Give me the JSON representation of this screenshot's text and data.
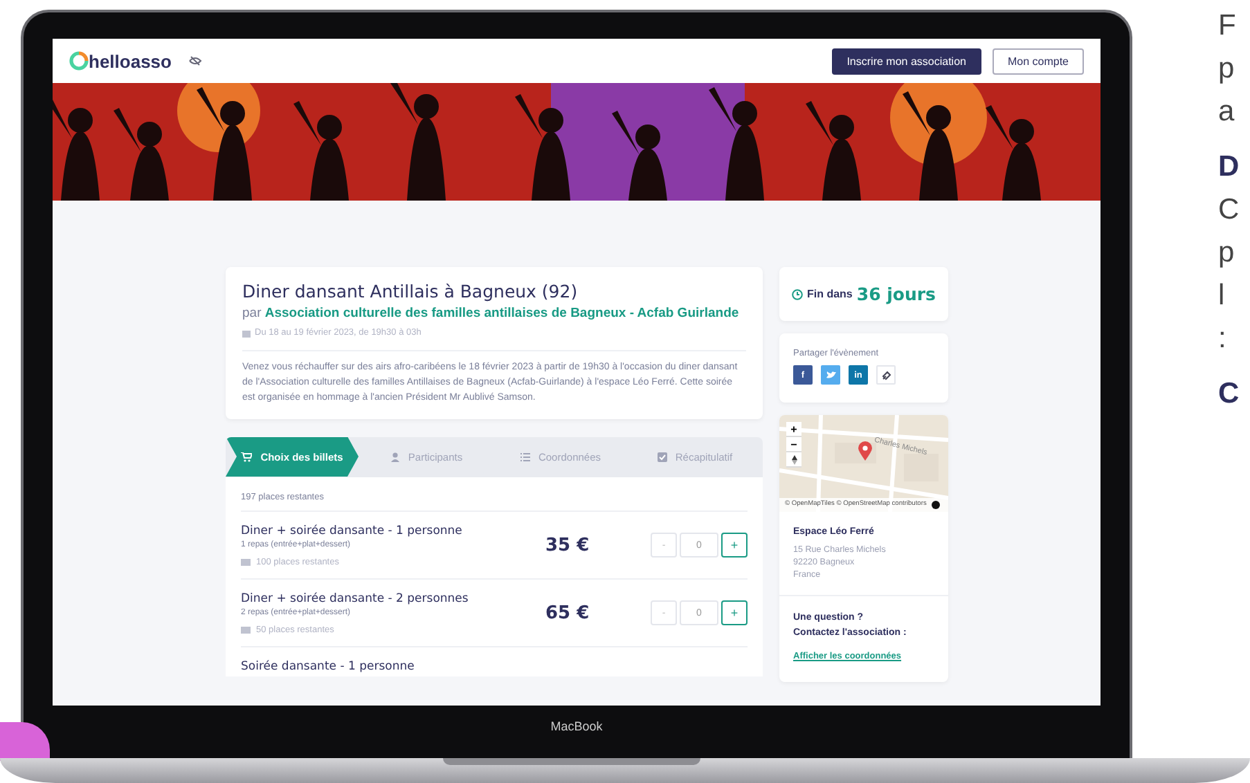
{
  "nav": {
    "logo": "helloasso",
    "primary_button": "Inscrire mon association",
    "secondary_button": "Mon compte"
  },
  "event": {
    "title": "Diner dansant Antillais à Bagneux (92)",
    "by_prefix": "par",
    "organizer": "Association culturelle des familles antillaises de Bagneux - Acfab Guirlande",
    "date": "Du 18 au 19 février 2023, de 19h30 à 03h",
    "description": "Venez vous réchauffer sur des airs afro-caribéens le 18 février 2023 à partir de 19h30 à l'occasion du diner dansant de l'Association culturelle des familles Antillaises de Bagneux (Acfab-Guirlande) à l'espace Léo Ferré. Cette soirée est organisée en hommage à l'ancien Président Mr Aublivé Samson."
  },
  "steps": [
    {
      "label": "Choix des billets",
      "selected": true,
      "kind": "cart"
    },
    {
      "label": "Participants",
      "selected": false,
      "kind": "person"
    },
    {
      "label": "Coordonnées",
      "selected": false,
      "kind": "list"
    },
    {
      "label": "Récapitulatif",
      "selected": false,
      "kind": "check"
    }
  ],
  "remaining": "197 places restantes",
  "tickets": [
    {
      "name": "Diner + soirée dansante - 1 personne",
      "detail": "1 repas (entrée+plat+dessert)",
      "availability": "100 places restantes",
      "price": "35 €",
      "decrement": "-",
      "quantity": "0",
      "increment": "+"
    },
    {
      "name": "Diner + soirée dansante - 2 personnes",
      "detail": "2 repas (entrée+plat+dessert)",
      "availability": "50 places restantes",
      "price": "65 €",
      "decrement": "-",
      "quantity": "0",
      "increment": "+"
    },
    {
      "name": "Soirée dansante - 1 personne"
    }
  ],
  "countdown": {
    "prefix": "Fin dans",
    "value": "36 jours"
  },
  "share": {
    "title": "Partager l'évènement",
    "buttons": [
      {
        "kind": "facebook",
        "label": "f"
      },
      {
        "kind": "twitter"
      },
      {
        "kind": "linkedin",
        "label": "in"
      },
      {
        "kind": "link"
      }
    ]
  },
  "map": {
    "zoom_in": "+",
    "zoom_out": "−",
    "street": "Charles Michels",
    "attribution": "© OpenMapTiles © OpenStreetMap contributors"
  },
  "venue": {
    "name": "Espace Léo Ferré",
    "address": [
      "15 Rue Charles Michels",
      "92220 Bagneux",
      "France"
    ]
  },
  "contact": {
    "question": "Une question ?",
    "prompt": "Contactez l'association :",
    "link": "Afficher les coordonnées"
  },
  "device_label": "MacBook",
  "side_text": [
    {
      "lines": [
        {
          "kind": "body",
          "text": "F"
        },
        {
          "kind": "body",
          "text": "p"
        },
        {
          "kind": "body",
          "text": "a"
        }
      ]
    },
    {
      "lines": [
        {
          "kind": "heading",
          "text": "D"
        },
        {
          "kind": "body",
          "text": "C"
        },
        {
          "kind": "body",
          "text": "p"
        },
        {
          "kind": "body",
          "text": "l"
        },
        {
          "kind": "body",
          "text": ":"
        }
      ]
    },
    {
      "lines": [
        {
          "kind": "heading",
          "text": "C"
        }
      ]
    }
  ]
}
